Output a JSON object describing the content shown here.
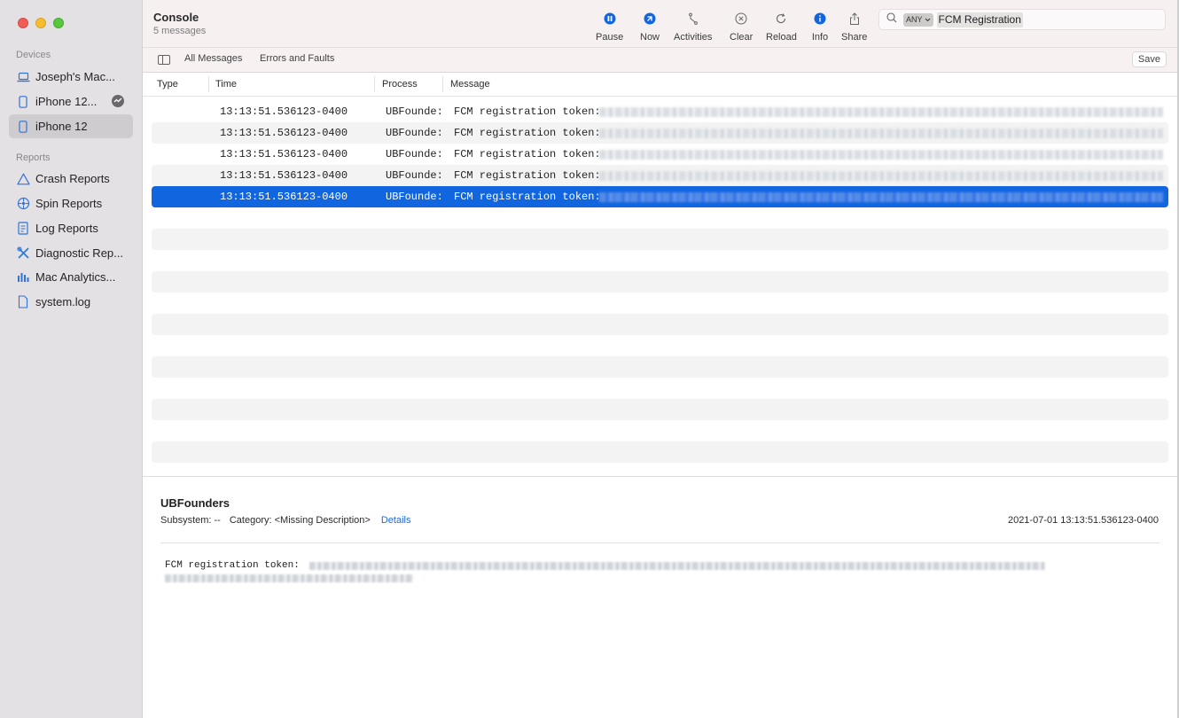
{
  "sidebar": {
    "devices_heading": "Devices",
    "devices": [
      {
        "label": "Joseph's Mac...",
        "icon": "laptop-icon"
      },
      {
        "label": "iPhone 12...",
        "icon": "iphone-icon"
      },
      {
        "label": "iPhone 12",
        "icon": "iphone-icon"
      }
    ],
    "reports_heading": "Reports",
    "reports": [
      {
        "label": "Crash Reports",
        "icon": "warning-triangle-icon"
      },
      {
        "label": "Spin Reports",
        "icon": "spin-icon"
      },
      {
        "label": "Log Reports",
        "icon": "log-document-icon"
      },
      {
        "label": "Diagnostic Rep...",
        "icon": "tools-icon"
      },
      {
        "label": "Mac Analytics...",
        "icon": "bar-chart-icon"
      },
      {
        "label": "system.log",
        "icon": "file-icon"
      }
    ]
  },
  "toolbar": {
    "title": "Console",
    "subtitle": "5 messages",
    "buttons": {
      "pause": "Pause",
      "now": "Now",
      "activities": "Activities",
      "clear": "Clear",
      "reload": "Reload",
      "info": "Info",
      "share": "Share"
    },
    "search": {
      "scope": "ANY",
      "token": "FCM Registration"
    }
  },
  "filterbar": {
    "all_messages": "All Messages",
    "errors_and_faults": "Errors and Faults",
    "save": "Save"
  },
  "table": {
    "columns": {
      "type": "Type",
      "time": "Time",
      "process": "Process",
      "message": "Message"
    },
    "rows": [
      {
        "time": "13:13:51.536123-0400",
        "process": "UBFounde:",
        "message": "FCM registration token:"
      },
      {
        "time": "13:13:51.536123-0400",
        "process": "UBFounde:",
        "message": "FCM registration token:"
      },
      {
        "time": "13:13:51.536123-0400",
        "process": "UBFounde:",
        "message": "FCM registration token:"
      },
      {
        "time": "13:13:51.536123-0400",
        "process": "UBFounde:",
        "message": "FCM registration token:"
      },
      {
        "time": "13:13:51.536123-0400",
        "process": "UBFounde:",
        "message": "FCM registration token:"
      }
    ]
  },
  "detail": {
    "process": "UBFounders",
    "subsystem_label": "Subsystem: --",
    "category_label": "Category: <Missing Description>",
    "details_link": "Details",
    "timestamp": "2021-07-01 13:13:51.536123-0400",
    "message_prefix": "FCM registration token:"
  },
  "colors": {
    "accent": "#1166e0",
    "sidebar_bg": "#e4e1e4",
    "toolbar_bg": "#f6f1f0"
  }
}
